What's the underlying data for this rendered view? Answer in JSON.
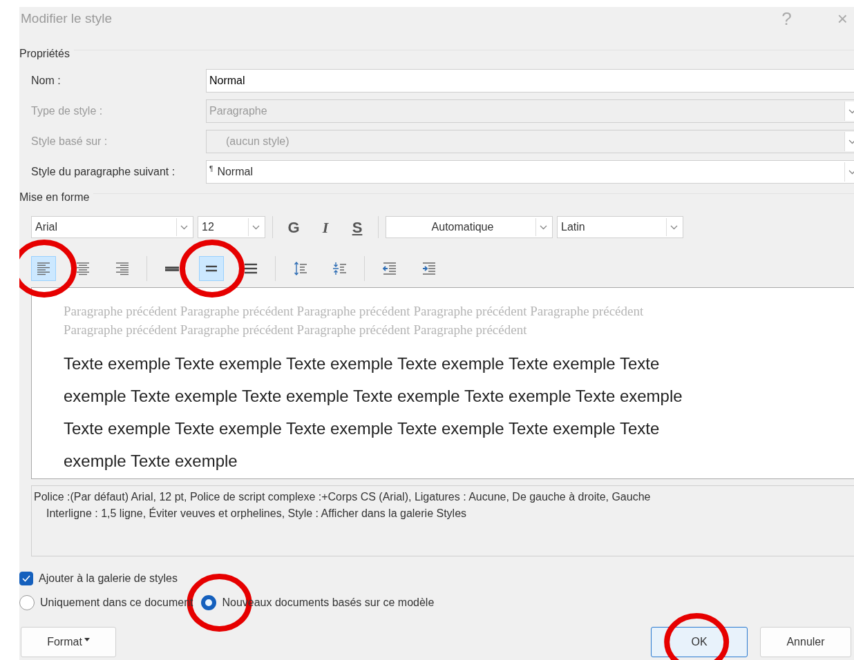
{
  "window": {
    "title": "Modifier le style",
    "help": "?",
    "close": "×"
  },
  "properties": {
    "heading": "Propriétés",
    "fields": [
      {
        "label": "Nom :",
        "kind": "text",
        "value": "Normal",
        "disabled": false
      },
      {
        "label": "Type de style :",
        "kind": "select",
        "value": "Paragraphe",
        "disabled": true
      },
      {
        "label": "Style basé sur :",
        "kind": "select",
        "value": "(aucun style)",
        "disabled": true
      },
      {
        "label": "Style du paragraphe suivant :",
        "kind": "select",
        "value": "Normal",
        "marker": "¶",
        "disabled": false
      }
    ]
  },
  "formatting": {
    "heading": "Mise en forme",
    "font": "Arial",
    "size": "12",
    "style_buttons": [
      {
        "label": "G",
        "kind": "bold"
      },
      {
        "label": "I",
        "kind": "italic"
      },
      {
        "label": "S",
        "kind": "underline"
      }
    ],
    "font_color": "Automatique",
    "script": "Latin",
    "paragraph_groups": [
      [
        {
          "kind": "align-left",
          "selected": true,
          "circled": true
        },
        {
          "kind": "align-center",
          "selected": false,
          "circled": false
        },
        {
          "kind": "align-right",
          "selected": false,
          "circled": false
        }
      ],
      [
        {
          "kind": "spacing-single",
          "selected": false,
          "circled": false
        },
        {
          "kind": "spacing-one-half",
          "selected": true,
          "circled": true
        },
        {
          "kind": "spacing-double",
          "selected": false,
          "circled": false
        }
      ],
      [
        {
          "kind": "space-increase",
          "selected": false,
          "circled": false
        },
        {
          "kind": "space-decrease",
          "selected": false,
          "circled": false
        }
      ],
      [
        {
          "kind": "indent-decrease",
          "selected": false,
          "circled": false
        },
        {
          "kind": "indent-increase",
          "selected": false,
          "circled": false
        }
      ]
    ]
  },
  "preview": {
    "previous_lines": [
      "Paragraphe précédent Paragraphe précédent Paragraphe précédent Paragraphe précédent Paragraphe précédent",
      "Paragraphe précédent Paragraphe précédent Paragraphe précédent Paragraphe précédent"
    ],
    "sample_lines": [
      "Texte exemple Texte exemple Texte exemple Texte exemple Texte exemple Texte",
      "exemple Texte exemple Texte exemple Texte exemple Texte exemple Texte exemple",
      "Texte exemple Texte exemple Texte exemple Texte exemple Texte exemple Texte",
      "exemple Texte exemple"
    ]
  },
  "description": [
    "Police :(Par défaut) Arial, 12 pt, Police de script complexe :+Corps CS (Arial), Ligatures : Aucune, De gauche à droite, Gauche",
    "Interligne : 1,5 ligne, Éviter veuves et orphelines, Style : Afficher dans la galerie Styles"
  ],
  "add_to_gallery": {
    "label": "Ajouter à la galerie de styles",
    "checked": true
  },
  "scope": [
    {
      "label": "Uniquement dans ce document",
      "selected": false,
      "circled": false
    },
    {
      "label": "Nouveaux documents basés sur ce modèle",
      "selected": true,
      "circled": true
    }
  ],
  "buttons": [
    {
      "label": "Format",
      "kind": "menu",
      "circled": false
    },
    {
      "label": "OK",
      "kind": "default",
      "circled": true
    },
    {
      "label": "Annuler",
      "kind": "normal",
      "circled": false
    }
  ]
}
